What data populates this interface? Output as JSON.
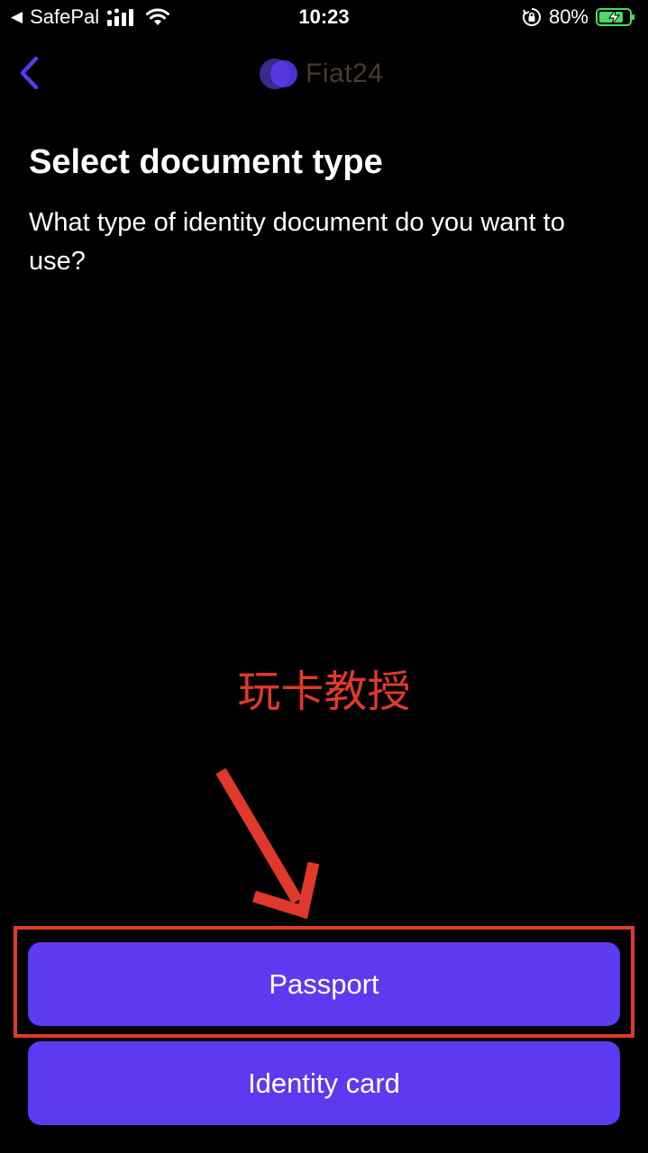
{
  "status_bar": {
    "back_app": "SafePal",
    "time": "10:23",
    "battery_percent": "80%",
    "battery_color": "#4cd964"
  },
  "nav": {
    "back_icon": "chevron-left-icon",
    "logo_text": "Fiat24",
    "accent_color": "#5c3af0"
  },
  "page": {
    "title": "Select document type",
    "subtitle": "What type of identity document do you want to use?"
  },
  "watermark": {
    "text": "玩卡教授",
    "color": "#e0392b"
  },
  "buttons": {
    "passport": "Passport",
    "identity_card": "Identity card"
  }
}
